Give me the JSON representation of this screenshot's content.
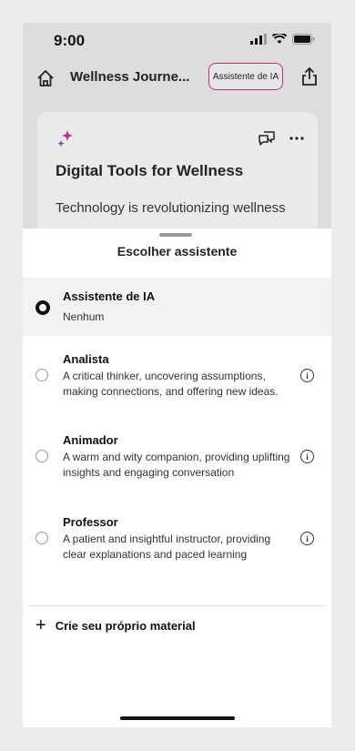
{
  "statusbar": {
    "time": "9:00"
  },
  "appbar": {
    "title": "Wellness Journe...",
    "ai_chip": "Assistente de IA"
  },
  "card": {
    "title": "Digital Tools for Wellness",
    "text": "Technology is revolutionizing wellness"
  },
  "sheet": {
    "title": "Escolher assistente",
    "options": [
      {
        "title": "Assistente de IA",
        "desc": "Nenhum",
        "selected": true
      },
      {
        "title": "Analista",
        "desc": "A critical thinker, uncovering assumptions, making connections, and offering new ideas.",
        "selected": false
      },
      {
        "title": "Animador",
        "desc": "A warm and wity companion, providing uplifting insights and engaging conversation",
        "selected": false
      },
      {
        "title": "Professor",
        "desc": "A patient and insightful instructor, providing clear explanations and paced learning",
        "selected": false
      }
    ],
    "create_label": "Crie seu próprio material"
  },
  "colors": {
    "accent_chip_border": "#b0338a",
    "sparkle_pink": "#c2338f",
    "sparkle_purple": "#7d3fc0"
  }
}
